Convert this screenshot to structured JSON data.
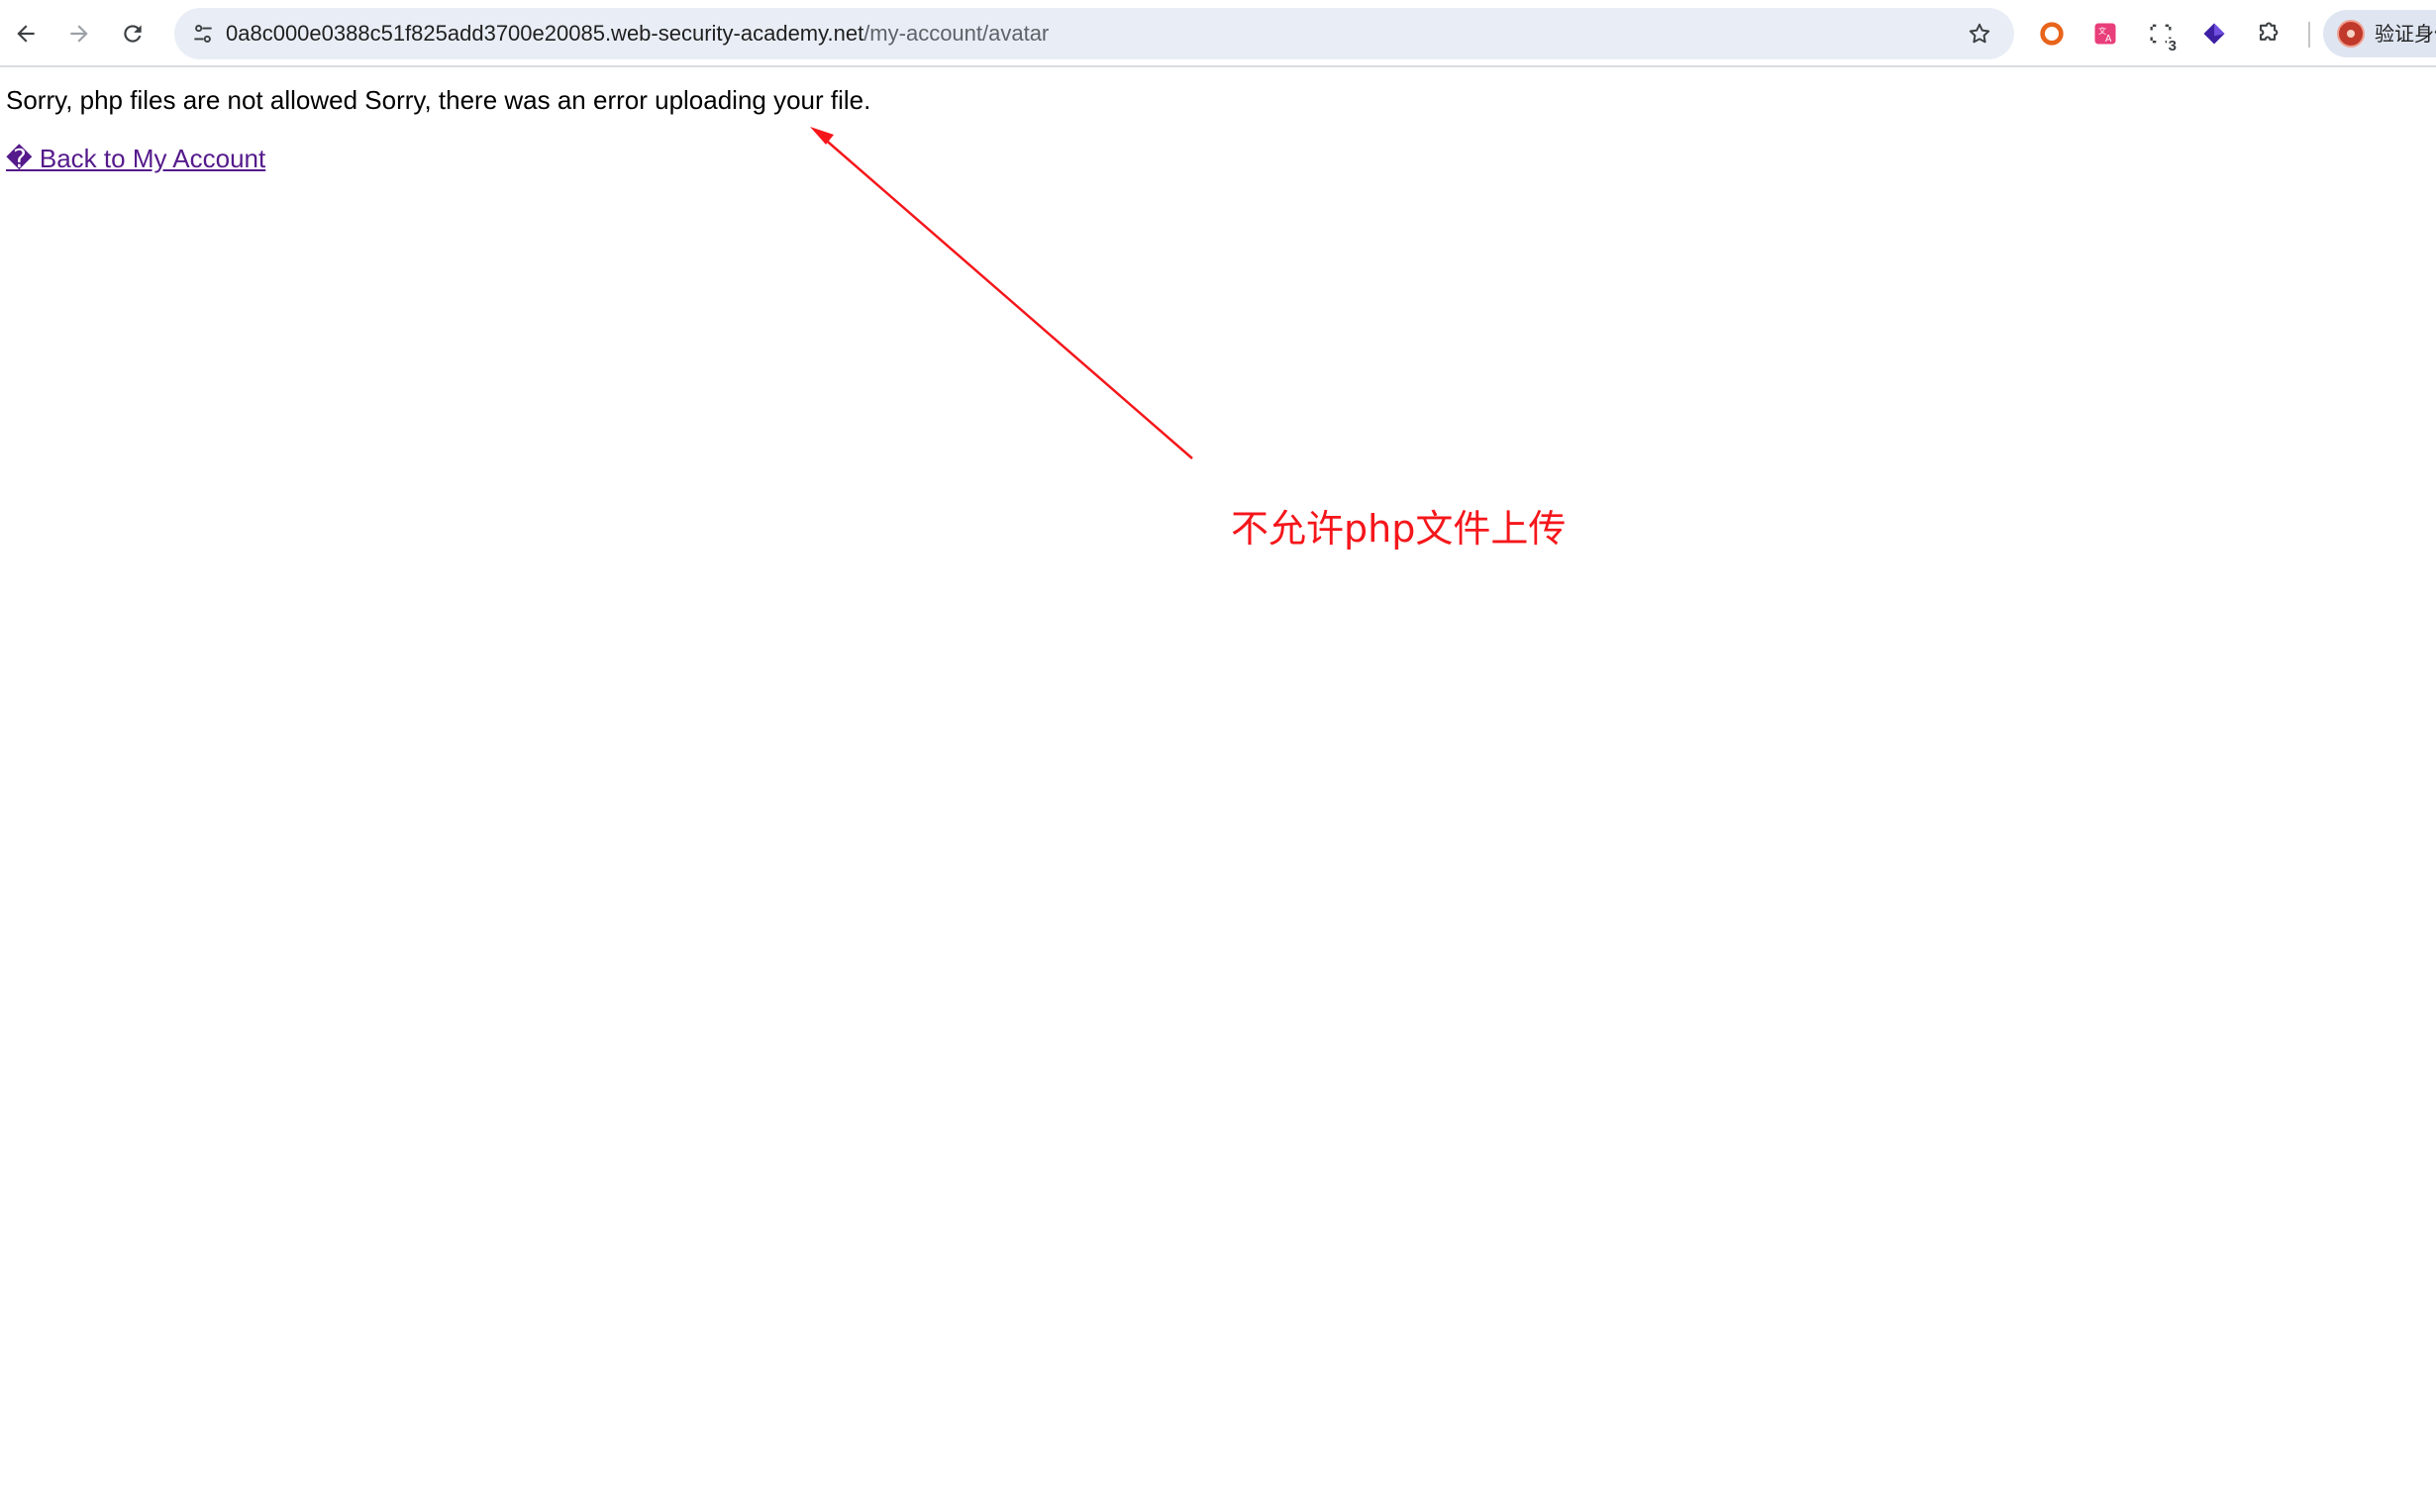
{
  "browser": {
    "url_host": "0a8c000e0388c51f825add3700e20085.web-security-academy.net",
    "url_path": "/my-account/avatar",
    "icons": {
      "back": "back-arrow-icon",
      "forward": "forward-arrow-icon",
      "reload": "reload-icon",
      "site_info": "site-settings-icon",
      "bookmark": "star-icon"
    },
    "extensions": [
      {
        "name": "extension-orange-ring-icon"
      },
      {
        "name": "extension-translate-icon"
      },
      {
        "name": "extension-screenshot-icon",
        "badge": "3"
      },
      {
        "name": "extension-purple-diamond-icon"
      },
      {
        "name": "extensions-puzzle-icon"
      }
    ],
    "profile_label": "验证身份"
  },
  "page": {
    "message": "Sorry, php files are not allowed Sorry, there was an error uploading your file.",
    "back_link": "� Back to My Account"
  },
  "annotation": {
    "text": "不允许php文件上传",
    "color": "#f5161b"
  },
  "colors": {
    "link": "#551a8b",
    "omnibox_bg": "#e9eef6"
  }
}
